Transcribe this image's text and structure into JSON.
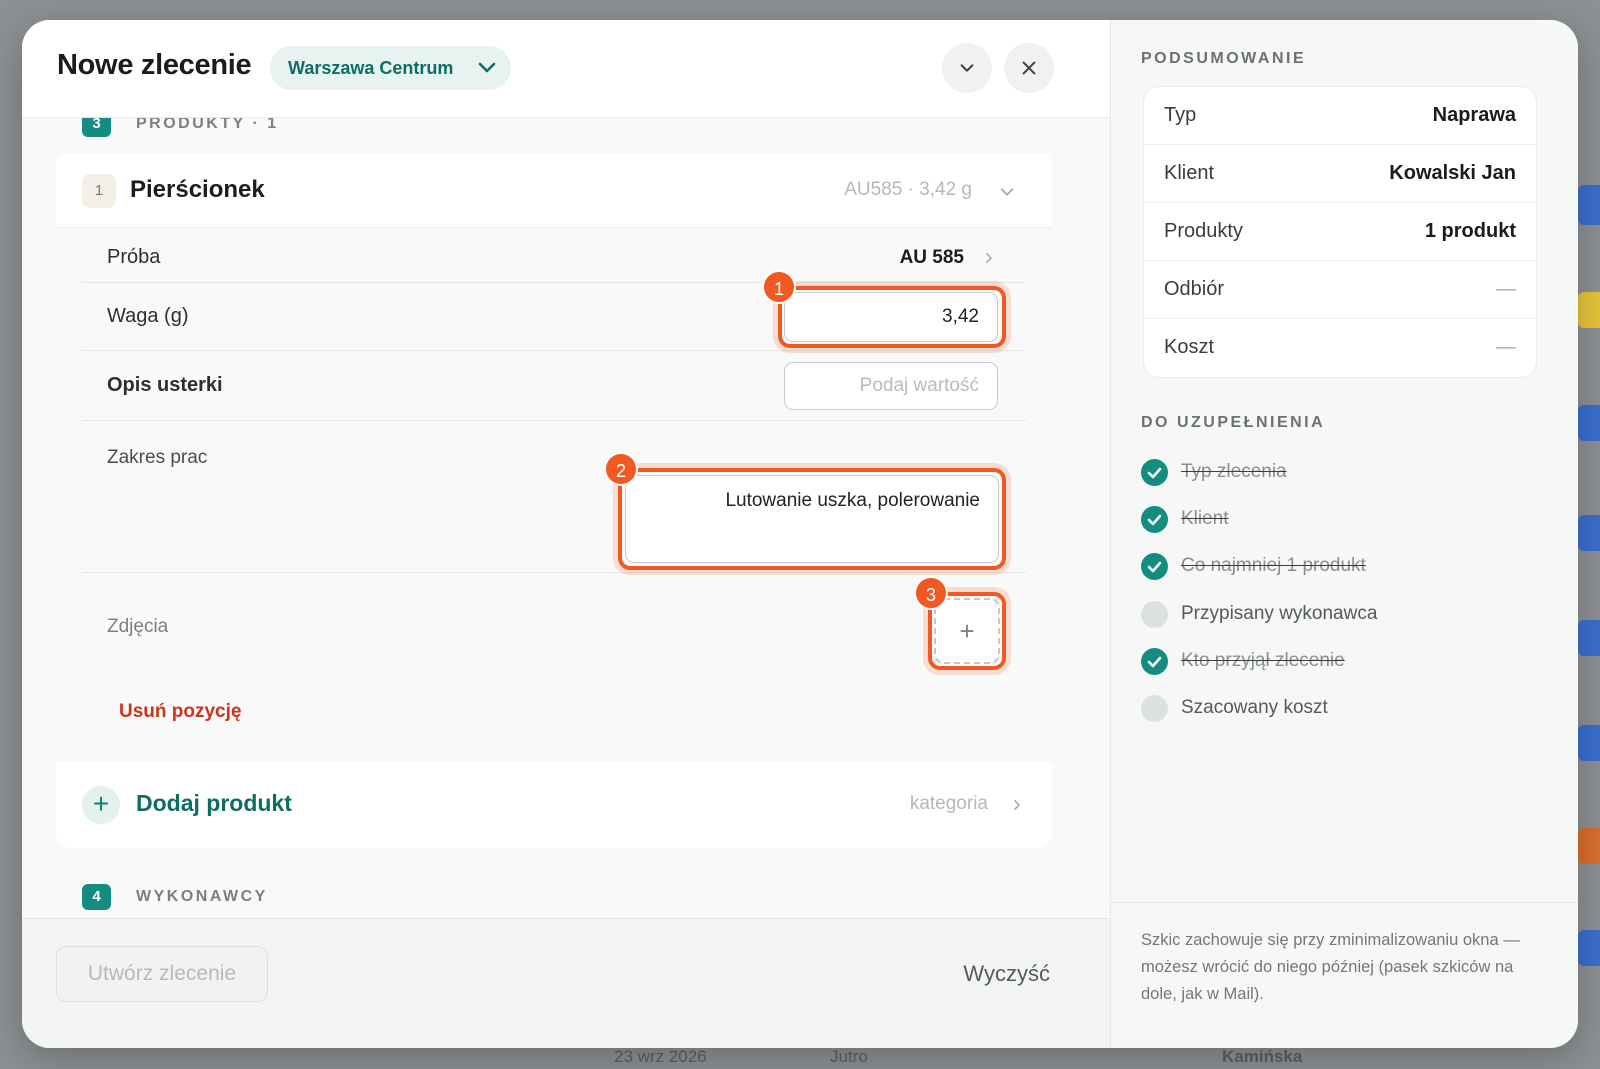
{
  "header": {
    "title": "Nowe zlecenie",
    "location": "Warszawa Centrum"
  },
  "sections": {
    "products": {
      "number": "3",
      "label": "PRODUKTY · 1"
    },
    "contractors": {
      "number": "4",
      "label": "WYKONAWCY"
    }
  },
  "product": {
    "index": "1",
    "name": "Pierścionek",
    "meta": "AU585 · 3,42 g",
    "fields": {
      "assay_label": "Próba",
      "assay_value": "AU 585",
      "weight_label": "Waga (g)",
      "weight_value": "3,42",
      "defect_label": "Opis usterki",
      "defect_placeholder": "Podaj wartość",
      "scope_label": "Zakres prac",
      "scope_value": "Lutowanie uszka, polerowanie",
      "photos_label": "Zdjęcia",
      "photos_add": "+"
    },
    "remove_label": "Usuń pozycję"
  },
  "add_product": {
    "icon": "+",
    "label": "Dodaj produkt",
    "category": "kategoria"
  },
  "highlights": [
    "1",
    "2",
    "3"
  ],
  "footer": {
    "create_label": "Utwórz zlecenie",
    "clear_label": "Wyczyść"
  },
  "summary": {
    "heading": "PODSUMOWANIE",
    "rows": [
      {
        "key": "Typ",
        "value": "Naprawa"
      },
      {
        "key": "Klient",
        "value": "Kowalski Jan"
      },
      {
        "key": "Produkty",
        "value": "1 produkt"
      },
      {
        "key": "Odbiór",
        "value": "—"
      },
      {
        "key": "Koszt",
        "value": "—"
      }
    ]
  },
  "checklist": {
    "heading": "DO UZUPEŁNIENIA",
    "items": [
      {
        "label": "Typ zlecenia",
        "done": true
      },
      {
        "label": "Klient",
        "done": true
      },
      {
        "label": "Co najmniej 1 produkt",
        "done": true
      },
      {
        "label": "Przypisany wykonawca",
        "done": false
      },
      {
        "label": "Kto przyjął zlecenie",
        "done": true
      },
      {
        "label": "Szacowany koszt",
        "done": false
      }
    ]
  },
  "note": "Szkic zachowuje się przy zminimalizowaniu okna — możesz wrócić do niego później (pasek szkiców na dole, jak w Mail).",
  "backdrop": {
    "date_text": "23 wrz 2026",
    "day_text": "Jutro",
    "name_text": "Kamińska"
  },
  "colors": {
    "accent": "#158c80",
    "highlight": "#f05a22",
    "danger": "#c8361b"
  }
}
